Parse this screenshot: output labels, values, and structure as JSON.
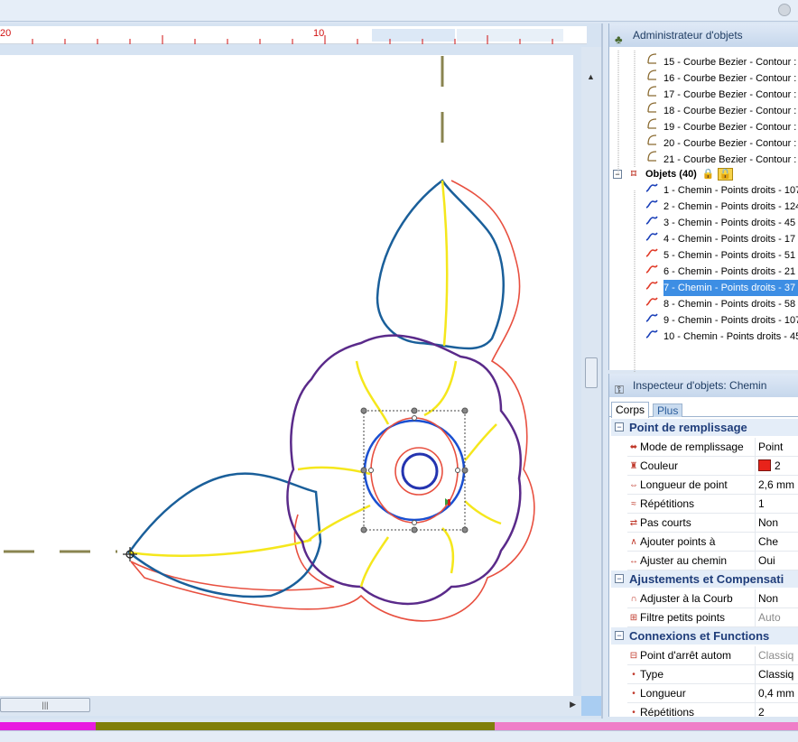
{
  "window": {
    "close_glyph": "1"
  },
  "ruler": {
    "label_left": "20",
    "label_mid": "10"
  },
  "object_admin": {
    "title": "Administrateur d'objets",
    "items": [
      {
        "label": "15 - Courbe Bezier - Contour :",
        "icon": "bezier-curve-icon"
      },
      {
        "label": "16 - Courbe Bezier - Contour :",
        "icon": "bezier-curve-icon"
      },
      {
        "label": "17 - Courbe Bezier - Contour :",
        "icon": "bezier-curve-icon"
      },
      {
        "label": "18 - Courbe Bezier - Contour :",
        "icon": "bezier-curve-icon"
      },
      {
        "label": "19 - Courbe Bezier - Contour :",
        "icon": "bezier-curve-icon"
      },
      {
        "label": "20 - Courbe Bezier - Contour :",
        "icon": "bezier-curve-icon"
      },
      {
        "label": "21 - Courbe Bezier - Contour :",
        "icon": "bezier-curve-icon"
      }
    ],
    "group": {
      "label": "Objets (40)",
      "icon": "objects-group-icon"
    },
    "paths": [
      {
        "label": "1 - Chemin - Points droits - 107",
        "color": "#1a3fb8"
      },
      {
        "label": "2 - Chemin - Points droits - 124",
        "color": "#1a3fb8"
      },
      {
        "label": "3 - Chemin - Points droits - 45",
        "color": "#1a3fb8"
      },
      {
        "label": "4 - Chemin - Points droits - 17",
        "color": "#1a3fb8"
      },
      {
        "label": "5 - Chemin - Points droits - 51",
        "color": "#e03a28"
      },
      {
        "label": "6 - Chemin - Points droits - 21",
        "color": "#e03a28"
      },
      {
        "label": "7 - Chemin - Points droits - 37",
        "color": "#e03a28",
        "selected": true
      },
      {
        "label": "8 - Chemin - Points droits - 58",
        "color": "#e03a28"
      },
      {
        "label": "9 - Chemin - Points droits - 107",
        "color": "#1a3fb8"
      },
      {
        "label": "10 - Chemin - Points droits - 45",
        "color": "#1a3fb8"
      }
    ]
  },
  "inspector": {
    "title": "Inspecteur d'objets: Chemin",
    "tabs": [
      "Corps",
      "Plus"
    ],
    "sections": [
      {
        "title": "Point de remplissage",
        "rows": [
          {
            "name": "Mode de remplissage",
            "value": "Point",
            "icon": "fill-mode-icon"
          },
          {
            "name": "Couleur",
            "value": "2",
            "icon": "color-icon",
            "swatch": "#e8231a"
          },
          {
            "name": "Longueur de point",
            "value": "2,6 mm",
            "icon": "stitch-length-icon"
          },
          {
            "name": "Répétitions",
            "value": "1",
            "icon": "repeat-icon"
          },
          {
            "name": "Pas courts",
            "value": "Non",
            "icon": "short-steps-icon"
          },
          {
            "name": "Ajouter points à",
            "value": "Che",
            "icon": "add-points-icon"
          },
          {
            "name": "Ajuster au chemin",
            "value": "Oui",
            "icon": "fit-path-icon"
          }
        ]
      },
      {
        "title": "Ajustements et Compensati",
        "rows": [
          {
            "name": "Adjuster à la Courb",
            "value": "Non",
            "icon": "curve-adjust-icon"
          },
          {
            "name": "Filtre petits points",
            "value": "Auto",
            "icon": "small-stitch-filter-icon",
            "muted": true
          }
        ]
      },
      {
        "title": "Connexions et Functions",
        "rows": [
          {
            "name": "Point d'arrêt autom",
            "value": "Classiq",
            "icon": "lock-stitch-icon",
            "muted": true
          },
          {
            "name": "Type",
            "value": "Classiq",
            "icon": "bullet-icon"
          },
          {
            "name": "Longueur",
            "value": "0,4 mm",
            "icon": "bullet-icon"
          },
          {
            "name": "Répétitions",
            "value": "2",
            "icon": "bullet-icon"
          }
        ]
      }
    ]
  },
  "colors": {
    "accent": "#3d8ee4",
    "thread_bar": [
      "#e81ce0",
      "#807f0a",
      "#ef7ec8"
    ]
  }
}
